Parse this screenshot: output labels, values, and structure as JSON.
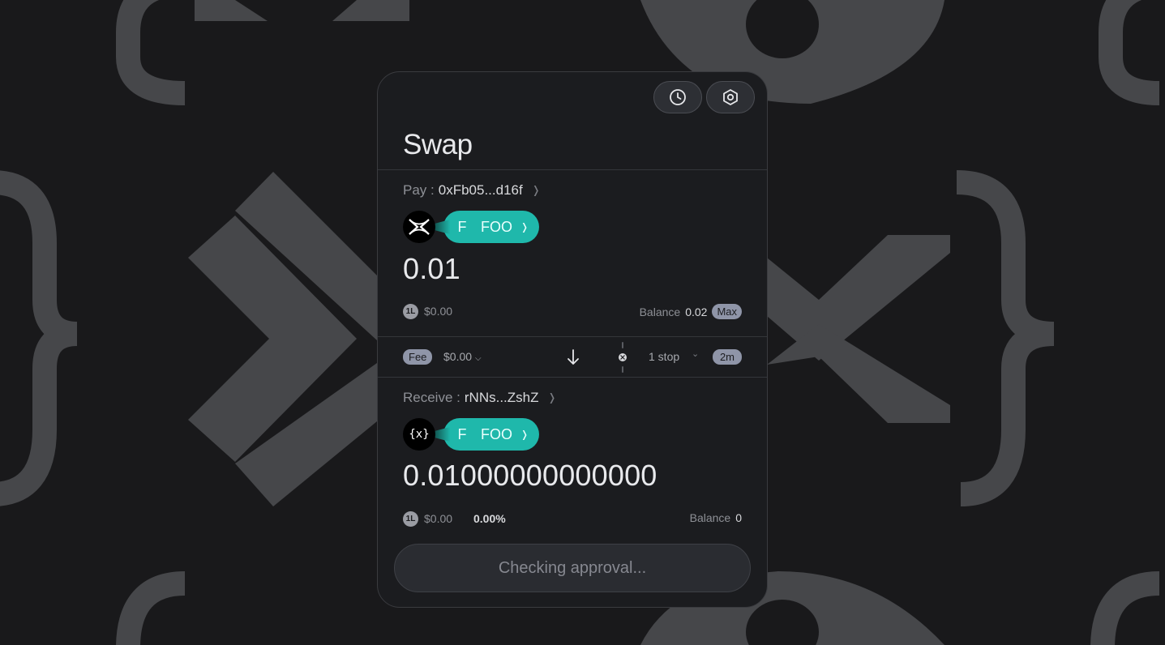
{
  "header": {
    "title": "Swap"
  },
  "icons": {
    "history": "clock-icon",
    "settings": "gear-icon"
  },
  "pay": {
    "label": "Pay :",
    "address": "0xFb05...d16f",
    "chain_icon": "x-logo-icon",
    "token_letter": "F",
    "token_symbol": "FOO",
    "amount": "0.01",
    "usd": "$0.00",
    "balance_label": "Balance",
    "balance_value": "0.02",
    "max_label": "Max"
  },
  "fee": {
    "label": "Fee",
    "value": "$0.00",
    "stops": "1 stop",
    "time": "2m"
  },
  "receive": {
    "label": "Receive :",
    "address": "rNNs...ZshZ",
    "chain_icon_text": "{x}",
    "token_letter": "F",
    "token_symbol": "FOO",
    "amount": "0.01000000000000",
    "usd": "$0.00",
    "price_impact": "0.00%",
    "balance_label": "Balance",
    "balance_value": "0"
  },
  "cta": {
    "label": "Checking approval..."
  },
  "colors": {
    "accent": "#1fb8ab",
    "background": "#19191b",
    "card": "#1b1c1f",
    "badge": "#8f95a8"
  }
}
